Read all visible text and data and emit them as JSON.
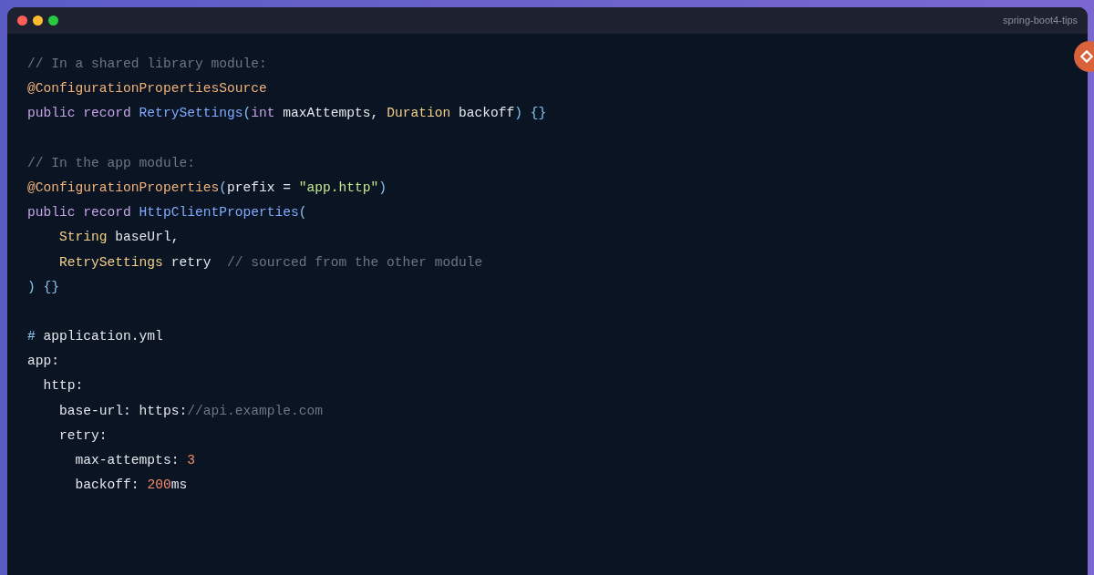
{
  "window": {
    "title": "spring-boot4-tips"
  },
  "code_lines": [
    {
      "kind": "code",
      "tokens": [
        {
          "t": "// In a shared library module:",
          "kind": "comment"
        }
      ]
    },
    {
      "kind": "code",
      "tokens": [
        {
          "t": "@ConfigurationPropertiesSource",
          "kind": "annotation"
        }
      ]
    },
    {
      "kind": "code",
      "tokens": [
        {
          "t": "public record ",
          "kind": "keyword"
        },
        {
          "t": "RetrySettings",
          "kind": "class"
        },
        {
          "t": "(",
          "kind": "punct"
        },
        {
          "t": "int ",
          "kind": "keyword"
        },
        {
          "t": "maxAttempts, ",
          "kind": "plain"
        },
        {
          "t": "Duration ",
          "kind": "type"
        },
        {
          "t": "backoff",
          "kind": "plain"
        },
        {
          "t": ") {}",
          "kind": "punct"
        }
      ]
    },
    {
      "kind": "blank"
    },
    {
      "kind": "code",
      "tokens": [
        {
          "t": "// In the app module:",
          "kind": "comment"
        }
      ]
    },
    {
      "kind": "code",
      "tokens": [
        {
          "t": "@ConfigurationProperties",
          "kind": "annotation"
        },
        {
          "t": "(",
          "kind": "punct"
        },
        {
          "t": "prefix = ",
          "kind": "plain"
        },
        {
          "t": "\"app.http\"",
          "kind": "string"
        },
        {
          "t": ")",
          "kind": "punct"
        }
      ]
    },
    {
      "kind": "code",
      "tokens": [
        {
          "t": "public record ",
          "kind": "keyword"
        },
        {
          "t": "HttpClientProperties",
          "kind": "class"
        },
        {
          "t": "(",
          "kind": "punct"
        }
      ]
    },
    {
      "kind": "code",
      "tokens": [
        {
          "t": "    String ",
          "kind": "type"
        },
        {
          "t": "baseUrl,",
          "kind": "plain"
        }
      ]
    },
    {
      "kind": "code",
      "tokens": [
        {
          "t": "    RetrySettings ",
          "kind": "type"
        },
        {
          "t": "retry  ",
          "kind": "plain"
        },
        {
          "t": "// sourced from the other module",
          "kind": "comment"
        }
      ]
    },
    {
      "kind": "code",
      "tokens": [
        {
          "t": ") {}",
          "kind": "punct"
        }
      ]
    },
    {
      "kind": "blank"
    },
    {
      "kind": "code",
      "tokens": [
        {
          "t": "# ",
          "kind": "punct"
        },
        {
          "t": "application.yml",
          "kind": "plain"
        }
      ]
    },
    {
      "kind": "code",
      "tokens": [
        {
          "t": "app:",
          "kind": "plain"
        }
      ]
    },
    {
      "kind": "code",
      "tokens": [
        {
          "t": "  http:",
          "kind": "plain"
        }
      ]
    },
    {
      "kind": "code",
      "tokens": [
        {
          "t": "    base-url: https:",
          "kind": "plain"
        },
        {
          "t": "//api.example.com",
          "kind": "comment"
        }
      ]
    },
    {
      "kind": "code",
      "tokens": [
        {
          "t": "    retry:",
          "kind": "plain"
        }
      ]
    },
    {
      "kind": "code",
      "tokens": [
        {
          "t": "      max-attempts: ",
          "kind": "plain"
        },
        {
          "t": "3",
          "kind": "number"
        }
      ]
    },
    {
      "kind": "code",
      "tokens": [
        {
          "t": "      backoff: ",
          "kind": "plain"
        },
        {
          "t": "200",
          "kind": "number"
        },
        {
          "t": "ms",
          "kind": "plain"
        }
      ]
    }
  ]
}
